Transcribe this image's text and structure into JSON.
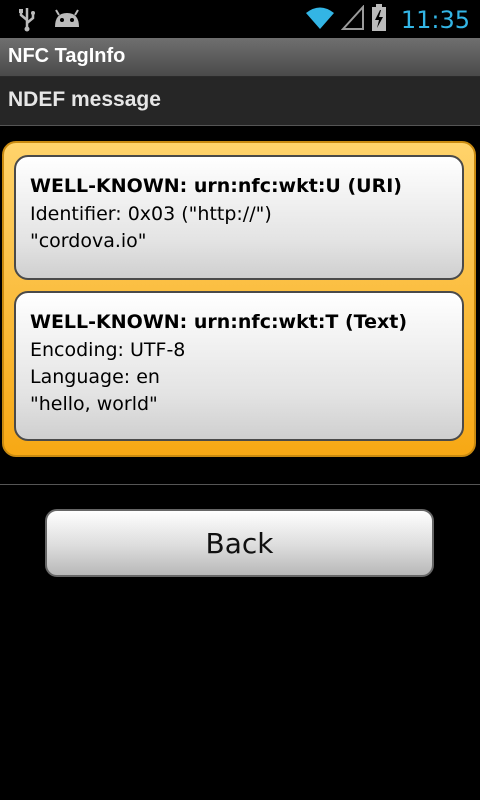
{
  "status_bar": {
    "time": "11:35",
    "icons": [
      "usb-icon",
      "android-icon",
      "wifi-icon",
      "signal-icon",
      "battery-charging-icon"
    ]
  },
  "app": {
    "title": "NFC TagInfo"
  },
  "section": {
    "title": "NDEF message"
  },
  "records": [
    {
      "title": "WELL-KNOWN: urn:nfc:wkt:U (URI)",
      "lines": [
        "Identifier: 0x03 (\"http://\")",
        "\"cordova.io\""
      ]
    },
    {
      "title": "WELL-KNOWN: urn:nfc:wkt:T (Text)",
      "lines": [
        "Encoding: UTF-8",
        "Language: en",
        "\"hello, world\""
      ]
    }
  ],
  "actions": {
    "back_label": "Back"
  },
  "colors": {
    "accent": "#33b5e5",
    "frame": "#f7a814"
  }
}
